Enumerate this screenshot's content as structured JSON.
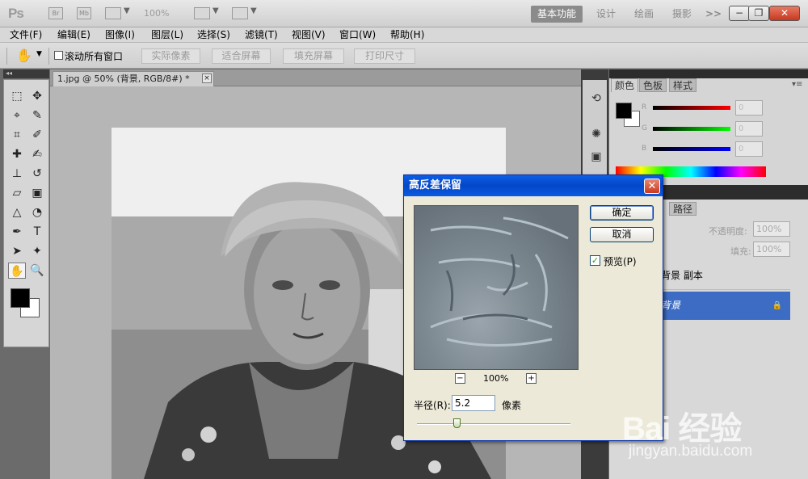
{
  "titlebar": {
    "app_logo": "Ps",
    "bridge_label": "Br",
    "minibridge_label": "Mb",
    "zoom_level": "100%",
    "workspaces": [
      "基本功能",
      "设计",
      "绘画",
      "摄影",
      ">>"
    ],
    "win_controls": {
      "minimize": "−",
      "maximize": "❐",
      "close": "✕"
    }
  },
  "menu": [
    "文件(F)",
    "编辑(E)",
    "图像(I)",
    "图层(L)",
    "选择(S)",
    "滤镜(T)",
    "视图(V)",
    "窗口(W)",
    "帮助(H)"
  ],
  "options": {
    "scroll_all_windows": "滚动所有窗口",
    "buttons": [
      "实际像素",
      "适合屏幕",
      "填充屏幕",
      "打印尺寸"
    ]
  },
  "document": {
    "tab_title": "1.jpg @ 50% (背景, RGB/8#) *",
    "tab_close": "×"
  },
  "tools": [
    {
      "name": "marquee-tool-icon",
      "glyph": "⬚"
    },
    {
      "name": "move-tool-icon",
      "glyph": "✥"
    },
    {
      "name": "lasso-tool-icon",
      "glyph": "⌖"
    },
    {
      "name": "quick-select-tool-icon",
      "glyph": "✎"
    },
    {
      "name": "crop-tool-icon",
      "glyph": "⌗"
    },
    {
      "name": "eyedropper-tool-icon",
      "glyph": "✐"
    },
    {
      "name": "healing-brush-tool-icon",
      "glyph": "✚"
    },
    {
      "name": "brush-tool-icon",
      "glyph": "✍"
    },
    {
      "name": "stamp-tool-icon",
      "glyph": "⊥"
    },
    {
      "name": "history-brush-tool-icon",
      "glyph": "↺"
    },
    {
      "name": "eraser-tool-icon",
      "glyph": "▱"
    },
    {
      "name": "gradient-tool-icon",
      "glyph": "▣"
    },
    {
      "name": "blur-tool-icon",
      "glyph": "△"
    },
    {
      "name": "dodge-tool-icon",
      "glyph": "◔"
    },
    {
      "name": "pen-tool-icon",
      "glyph": "✒"
    },
    {
      "name": "type-tool-icon",
      "glyph": "T"
    },
    {
      "name": "path-select-tool-icon",
      "glyph": "➤"
    },
    {
      "name": "shape-tool-icon",
      "glyph": "✦"
    },
    {
      "name": "hand-tool-icon",
      "glyph": "✋"
    },
    {
      "name": "zoom-tool-icon",
      "glyph": "🔍"
    }
  ],
  "color_panel": {
    "tabs": [
      "颜色",
      "色板",
      "样式"
    ],
    "channels": [
      "R",
      "G",
      "B"
    ],
    "values": [
      "0",
      "0",
      "0"
    ]
  },
  "layers_panel": {
    "tab": "路径",
    "opacity_label": "不透明度:",
    "opacity_value": "100%",
    "fill_label": "填充:",
    "fill_value": "100%",
    "layers": [
      "背景 副本",
      "背景"
    ]
  },
  "dialog": {
    "title": "高反差保留",
    "ok": "确定",
    "cancel": "取消",
    "preview_label": "预览(P)",
    "preview_checked": true,
    "zoom": "100%",
    "zoom_minus": "−",
    "zoom_plus": "+",
    "radius_label": "半径(R):",
    "radius_value": "5.2",
    "radius_unit": "像素",
    "radius_slider_fraction": 0.26
  },
  "watermark": {
    "logo": "Bai 经验",
    "url": "jingyan.baidu.com"
  },
  "colors": {
    "dialog_title": "#0a5be0",
    "selected_layer": "#3c6cc4",
    "workspace_active": "#8b8b8b"
  }
}
